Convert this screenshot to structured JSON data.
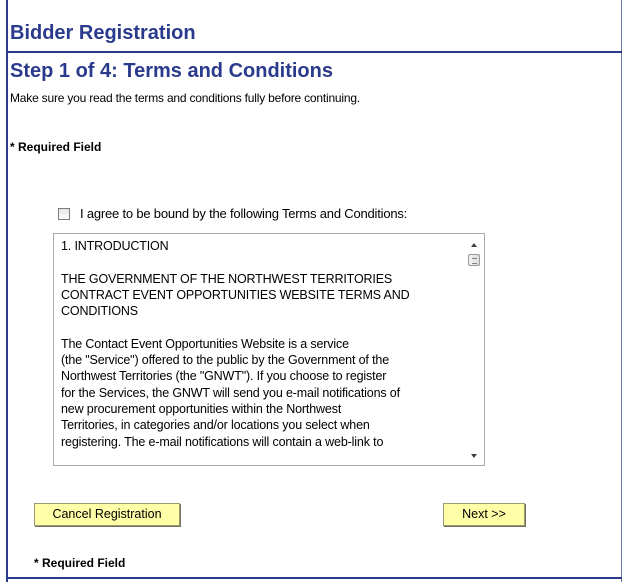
{
  "header": {
    "title": "Bidder Registration"
  },
  "step": {
    "title": "Step 1 of 4: Terms and Conditions",
    "instructions": "Make sure you read the terms and conditions fully before continuing."
  },
  "required_field_label": "* Required Field",
  "agreement": {
    "checked": false,
    "label": "I agree to be bound by the following Terms and Conditions:"
  },
  "terms": {
    "text": "1. INTRODUCTION\n\nTHE GOVERNMENT OF THE NORTHWEST TERRITORIES\nCONTRACT EVENT OPPORTUNITIES WEBSITE TERMS AND\nCONDITIONS\n\nThe Contact Event Opportunities Website is a service\n(the \"Service\") offered to the public by the Government of the\nNorthwest Territories (the \"GNWT\"). If you choose to register\nfor the Services, the GNWT will send you e-mail notifications of\nnew procurement opportunities within the Northwest\nTerritories, in categories and/or locations you select when\nregistering. The e-mail notifications will contain a web-link to"
  },
  "buttons": {
    "cancel_label": "Cancel Registration",
    "next_label": "Next >>"
  },
  "colors": {
    "heading": "#2a3a8c",
    "button_bg": "#ffffa8"
  }
}
